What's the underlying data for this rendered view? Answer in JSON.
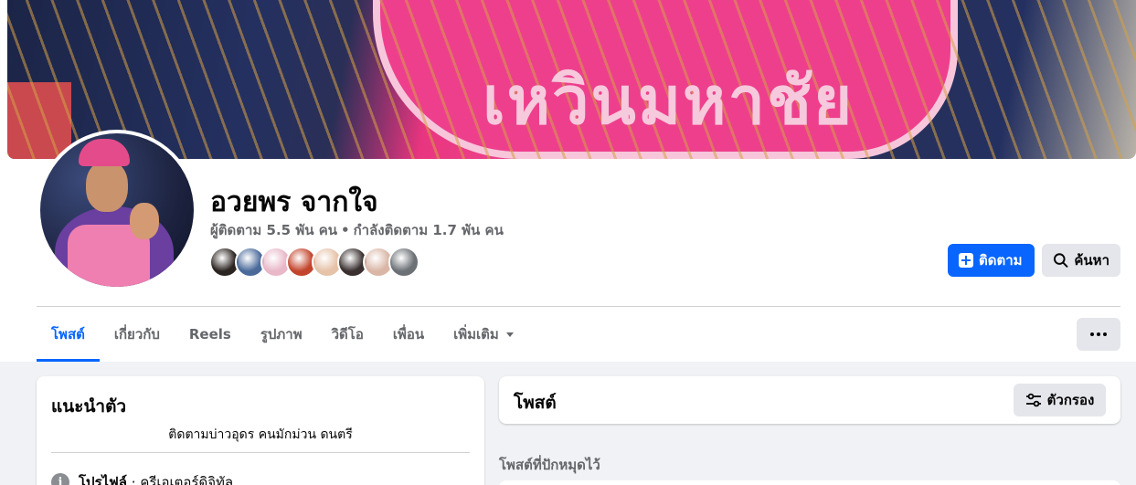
{
  "cover": {
    "text": "เหวินมหาชัย"
  },
  "profile": {
    "name": "อวยพร จากใจ",
    "followers": "ผู้ติดตาม 5.5 พัน คน",
    "separator": "•",
    "following": "กำลังติดตาม 1.7 พัน คน",
    "friend_avatar_colors": [
      "#2b2420",
      "#4a6a9a",
      "#e8b7c8",
      "#c3442c",
      "#e6c2a8",
      "#3a3030",
      "#d9b6a6",
      "#6c7176"
    ]
  },
  "actions": {
    "follow_label": "ติดตาม",
    "search_label": "ค้นหา"
  },
  "tabs": [
    {
      "label": "โพสต์",
      "active": true
    },
    {
      "label": "เกี่ยวกับ",
      "active": false
    },
    {
      "label": "Reels",
      "active": false
    },
    {
      "label": "รูปภาพ",
      "active": false
    },
    {
      "label": "วิดีโอ",
      "active": false
    },
    {
      "label": "เพื่อน",
      "active": false
    },
    {
      "label": "เพิ่มเติม",
      "active": false
    }
  ],
  "intro": {
    "title": "แนะนำตัว",
    "bio": "ติดตามบ่าวอุดร คนมักม่วน ดนตรี",
    "row_label": "โปรไฟล์",
    "row_value": "ครีเอเตอร์ดิจิทัล",
    "info_icon": "i"
  },
  "posts": {
    "title": "โพสต์",
    "filter_label": "ตัวกรอง",
    "pinned_label": "โพสต์ที่ปักหมุดไว้"
  },
  "colors": {
    "accent": "#0866ff",
    "background": "#f0f2f5",
    "secondary_text": "#65676b"
  }
}
